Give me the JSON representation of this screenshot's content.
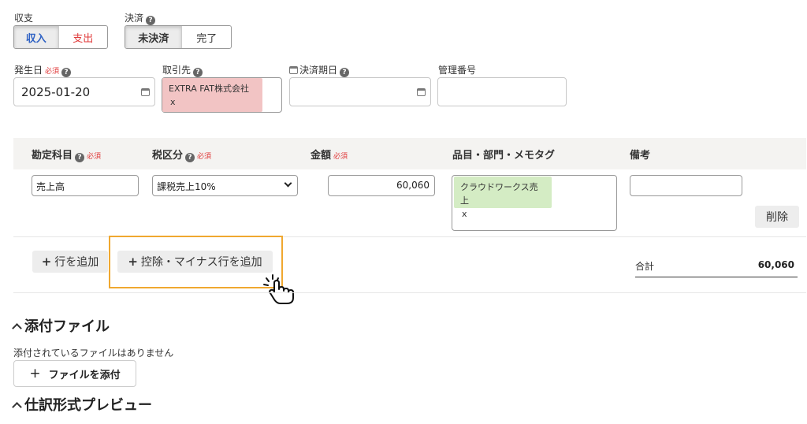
{
  "income": {
    "label": "収支",
    "options": [
      "収入",
      "支出"
    ],
    "colors": {
      "income": "#2f62c4",
      "expense": "#e03a3a"
    }
  },
  "settlement": {
    "label": "決済",
    "options": [
      "未決済",
      "完了"
    ]
  },
  "date_field": {
    "label": "発生日",
    "required": "必須",
    "value": "2025-01-20"
  },
  "partner": {
    "label": "取引先",
    "value": "EXTRA FAT株式会社",
    "remove": "x",
    "chip_color": "#f2c4c4"
  },
  "due_date": {
    "label": "決済期日"
  },
  "mgmt_no": {
    "label": "管理番号"
  },
  "table": {
    "headers": {
      "account": "勘定科目",
      "tax": "税区分",
      "amount": "金額",
      "tags": "品目・部門・メモタグ",
      "memo": "備考"
    },
    "required": "必須",
    "row": {
      "account": "売上高",
      "tax": "課税売上10%",
      "amount": "60,060",
      "tag": "クラウドワークス売上",
      "tag_remove": "x",
      "tag_color": "#d4ecc4",
      "delete": "削除"
    }
  },
  "actions": {
    "add_row": "行を追加",
    "add_minus_row": "控除・マイナス行を追加",
    "highlight_color": "#f0a830"
  },
  "total": {
    "label": "合計",
    "value": "60,060"
  },
  "attachments": {
    "title": "添付ファイル",
    "empty": "添付されているファイルはありません",
    "add_button": "ファイルを添付"
  },
  "journal_preview": {
    "title": "仕訳形式プレビュー"
  }
}
